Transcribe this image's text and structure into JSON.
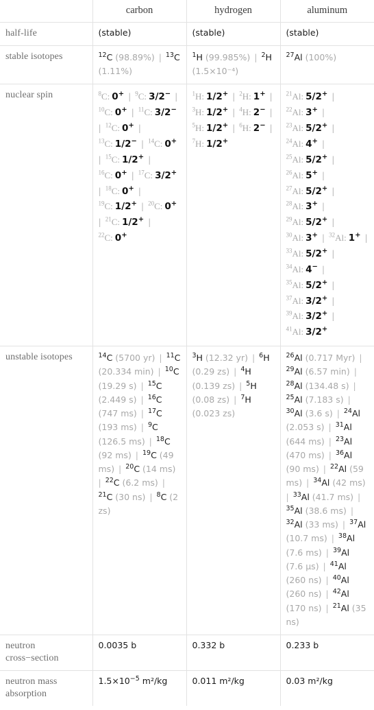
{
  "table": {
    "columns": [
      "carbon",
      "hydrogen",
      "aluminum"
    ],
    "corner_label": "",
    "rows": [
      {
        "label": "half-life",
        "carbon": "(stable)",
        "hydrogen": "(stable)",
        "aluminum": "(stable)"
      },
      {
        "label": "stable isotopes",
        "carbon": "12C (98.89%) | 13C (1.11%)",
        "hydrogen": "1H (99.985%) | 2H (1.5×10^-4)",
        "aluminum": "27Al (100%)"
      },
      {
        "label": "nuclear spin",
        "carbon": "8C: 0+ | 9C: 3/2- | 10C: 0+ | 11C: 3/2- | 12C: 0+ | 13C: 1/2- | 14C: 0+ | 15C: 1/2+ | 16C: 0+ | 17C: 3/2+ | 18C: 0+ | 19C: 1/2+ | 20C: 0+ | 21C: 1/2+ | 22C: 0+",
        "hydrogen": "1H: 1/2+ | 2H: 1+ | 3H: 1/2+ | 4H: 2- | 5H: 1/2+ | 6H: 2- | 7H: 1/2+",
        "aluminum": "21Al: 5/2+ | 22Al: 3+ | 23Al: 5/2+ | 24Al: 4+ | 25Al: 5/2+ | 26Al: 5+ | 27Al: 5/2+ | 28Al: 3+ | 29Al: 5/2+ | 30Al: 3+ | 32Al: 1+ | 33Al: 5/2+ | 34Al: 4- | 35Al: 5/2+ | 37Al: 3/2+ | 39Al: 3/2+ | 41Al: 3/2+"
      },
      {
        "label": "unstable isotopes",
        "carbon": "14C (5700 yr) | 11C (20.334 min) | 10C (19.29 s) | 15C (2.449 s) | 16C (747 ms) | 17C (193 ms) | 9C (126.5 ms) | 18C (92 ms) | 19C (49 ms) | 20C (14 ms) | 22C (6.2 ms) | 21C (30 ns) | 8C (2 zs)",
        "hydrogen": "3H (12.32 yr) | 6H (0.29 zs) | 4H (0.139 zs) | 5H (0.08 zs) | 7H (0.023 zs)",
        "aluminum": "26Al (0.717 Myr) | 29Al (6.57 min) | 28Al (134.48 s) | 25Al (7.183 s) | 30Al (3.6 s) | 24Al (2.053 s) | 31Al (644 ms) | 23Al (470 ms) | 36Al (90 ms) | 22Al (59 ms) | 34Al (42 ms) | 33Al (41.7 ms) | 35Al (38.6 ms) | 32Al (33 ms) | 37Al (10.7 ms) | 38Al (7.6 ms) | 39Al (7.6 µs) | 41Al (260 ns) | 40Al (260 ns) | 42Al (170 ns) | 21Al (35 ns)"
      },
      {
        "label": "neutron cross-section",
        "carbon": "0.0035 b",
        "hydrogen": "0.332 b",
        "aluminum": "0.233 b"
      },
      {
        "label": "neutron mass absorption",
        "carbon": "1.5×10^-5 m^2/kg",
        "hydrogen": "0.011 m²/kg",
        "aluminum": "0.03 m²/kg"
      }
    ]
  },
  "half_life": {
    "carbon": "(stable)",
    "hydrogen": "(stable)",
    "aluminum": "(stable)"
  },
  "stable_isotopes": {
    "carbon": [
      {
        "mass": "12",
        "element": "C",
        "abundance": "(98.89%)"
      },
      {
        "mass": "13",
        "element": "C",
        "abundance": "(1.11%)"
      }
    ],
    "hydrogen": [
      {
        "mass": "1",
        "element": "H",
        "abundance": "(99.985%)"
      },
      {
        "mass": "2",
        "element": "H",
        "abundance": "(1.5×10⁻⁴)"
      }
    ],
    "aluminum": [
      {
        "mass": "27",
        "element": "Al",
        "abundance": "(100%)"
      }
    ]
  },
  "nuclear_spin": {
    "carbon": [
      {
        "mass": "8",
        "element": "C",
        "spin": "0",
        "parity": "+"
      },
      {
        "mass": "9",
        "element": "C",
        "spin": "3/2",
        "parity": "−"
      },
      {
        "mass": "10",
        "element": "C",
        "spin": "0",
        "parity": "+"
      },
      {
        "mass": "11",
        "element": "C",
        "spin": "3/2",
        "parity": "−"
      },
      {
        "mass": "12",
        "element": "C",
        "spin": "0",
        "parity": "+"
      },
      {
        "mass": "13",
        "element": "C",
        "spin": "1/2",
        "parity": "−"
      },
      {
        "mass": "14",
        "element": "C",
        "spin": "0",
        "parity": "+"
      },
      {
        "mass": "15",
        "element": "C",
        "spin": "1/2",
        "parity": "+"
      },
      {
        "mass": "16",
        "element": "C",
        "spin": "0",
        "parity": "+"
      },
      {
        "mass": "17",
        "element": "C",
        "spin": "3/2",
        "parity": "+"
      },
      {
        "mass": "18",
        "element": "C",
        "spin": "0",
        "parity": "+"
      },
      {
        "mass": "19",
        "element": "C",
        "spin": "1/2",
        "parity": "+"
      },
      {
        "mass": "20",
        "element": "C",
        "spin": "0",
        "parity": "+"
      },
      {
        "mass": "21",
        "element": "C",
        "spin": "1/2",
        "parity": "+"
      },
      {
        "mass": "22",
        "element": "C",
        "spin": "0",
        "parity": "+"
      }
    ],
    "hydrogen": [
      {
        "mass": "1",
        "element": "H",
        "spin": "1/2",
        "parity": "+"
      },
      {
        "mass": "2",
        "element": "H",
        "spin": "1",
        "parity": "+"
      },
      {
        "mass": "3",
        "element": "H",
        "spin": "1/2",
        "parity": "+"
      },
      {
        "mass": "4",
        "element": "H",
        "spin": "2",
        "parity": "−"
      },
      {
        "mass": "5",
        "element": "H",
        "spin": "1/2",
        "parity": "+"
      },
      {
        "mass": "6",
        "element": "H",
        "spin": "2",
        "parity": "−"
      },
      {
        "mass": "7",
        "element": "H",
        "spin": "1/2",
        "parity": "+"
      }
    ],
    "aluminum": [
      {
        "mass": "21",
        "element": "Al",
        "spin": "5/2",
        "parity": "+"
      },
      {
        "mass": "22",
        "element": "Al",
        "spin": "3",
        "parity": "+"
      },
      {
        "mass": "23",
        "element": "Al",
        "spin": "5/2",
        "parity": "+"
      },
      {
        "mass": "24",
        "element": "Al",
        "spin": "4",
        "parity": "+"
      },
      {
        "mass": "25",
        "element": "Al",
        "spin": "5/2",
        "parity": "+"
      },
      {
        "mass": "26",
        "element": "Al",
        "spin": "5",
        "parity": "+"
      },
      {
        "mass": "27",
        "element": "Al",
        "spin": "5/2",
        "parity": "+"
      },
      {
        "mass": "28",
        "element": "Al",
        "spin": "3",
        "parity": "+"
      },
      {
        "mass": "29",
        "element": "Al",
        "spin": "5/2",
        "parity": "+"
      },
      {
        "mass": "30",
        "element": "Al",
        "spin": "3",
        "parity": "+"
      },
      {
        "mass": "32",
        "element": "Al",
        "spin": "1",
        "parity": "+"
      },
      {
        "mass": "33",
        "element": "Al",
        "spin": "5/2",
        "parity": "+"
      },
      {
        "mass": "34",
        "element": "Al",
        "spin": "4",
        "parity": "−"
      },
      {
        "mass": "35",
        "element": "Al",
        "spin": "5/2",
        "parity": "+"
      },
      {
        "mass": "37",
        "element": "Al",
        "spin": "3/2",
        "parity": "+"
      },
      {
        "mass": "39",
        "element": "Al",
        "spin": "3/2",
        "parity": "+"
      },
      {
        "mass": "41",
        "element": "Al",
        "spin": "3/2",
        "parity": "+"
      }
    ]
  },
  "unstable_isotopes": {
    "carbon": [
      {
        "mass": "14",
        "element": "C",
        "half_life": "(5700 yr)"
      },
      {
        "mass": "11",
        "element": "C",
        "half_life": "(20.334 min)"
      },
      {
        "mass": "10",
        "element": "C",
        "half_life": "(19.29 s)"
      },
      {
        "mass": "15",
        "element": "C",
        "half_life": "(2.449 s)"
      },
      {
        "mass": "16",
        "element": "C",
        "half_life": "(747 ms)"
      },
      {
        "mass": "17",
        "element": "C",
        "half_life": "(193 ms)"
      },
      {
        "mass": "9",
        "element": "C",
        "half_life": "(126.5 ms)"
      },
      {
        "mass": "18",
        "element": "C",
        "half_life": "(92 ms)"
      },
      {
        "mass": "19",
        "element": "C",
        "half_life": "(49 ms)"
      },
      {
        "mass": "20",
        "element": "C",
        "half_life": "(14 ms)"
      },
      {
        "mass": "22",
        "element": "C",
        "half_life": "(6.2 ms)"
      },
      {
        "mass": "21",
        "element": "C",
        "half_life": "(30 ns)"
      },
      {
        "mass": "8",
        "element": "C",
        "half_life": "(2 zs)"
      }
    ],
    "hydrogen": [
      {
        "mass": "3",
        "element": "H",
        "half_life": "(12.32 yr)"
      },
      {
        "mass": "6",
        "element": "H",
        "half_life": "(0.29 zs)"
      },
      {
        "mass": "4",
        "element": "H",
        "half_life": "(0.139 zs)"
      },
      {
        "mass": "5",
        "element": "H",
        "half_life": "(0.08 zs)"
      },
      {
        "mass": "7",
        "element": "H",
        "half_life": "(0.023 zs)"
      }
    ],
    "aluminum": [
      {
        "mass": "26",
        "element": "Al",
        "half_life": "(0.717 Myr)"
      },
      {
        "mass": "29",
        "element": "Al",
        "half_life": "(6.57 min)"
      },
      {
        "mass": "28",
        "element": "Al",
        "half_life": "(134.48 s)"
      },
      {
        "mass": "25",
        "element": "Al",
        "half_life": "(7.183 s)"
      },
      {
        "mass": "30",
        "element": "Al",
        "half_life": "(3.6 s)"
      },
      {
        "mass": "24",
        "element": "Al",
        "half_life": "(2.053 s)"
      },
      {
        "mass": "31",
        "element": "Al",
        "half_life": "(644 ms)"
      },
      {
        "mass": "23",
        "element": "Al",
        "half_life": "(470 ms)"
      },
      {
        "mass": "36",
        "element": "Al",
        "half_life": "(90 ms)"
      },
      {
        "mass": "22",
        "element": "Al",
        "half_life": "(59 ms)"
      },
      {
        "mass": "34",
        "element": "Al",
        "half_life": "(42 ms)"
      },
      {
        "mass": "33",
        "element": "Al",
        "half_life": "(41.7 ms)"
      },
      {
        "mass": "35",
        "element": "Al",
        "half_life": "(38.6 ms)"
      },
      {
        "mass": "32",
        "element": "Al",
        "half_life": "(33 ms)"
      },
      {
        "mass": "37",
        "element": "Al",
        "half_life": "(10.7 ms)"
      },
      {
        "mass": "38",
        "element": "Al",
        "half_life": "(7.6 ms)"
      },
      {
        "mass": "39",
        "element": "Al",
        "half_life": "(7.6 µs)"
      },
      {
        "mass": "41",
        "element": "Al",
        "half_life": "(260 ns)"
      },
      {
        "mass": "40",
        "element": "Al",
        "half_life": "(260 ns)"
      },
      {
        "mass": "42",
        "element": "Al",
        "half_life": "(170 ns)"
      },
      {
        "mass": "21",
        "element": "Al",
        "half_life": "(35 ns)"
      }
    ]
  },
  "neutron_cross_section": {
    "carbon": "0.0035 b",
    "hydrogen": "0.332 b",
    "aluminum": "0.233 b"
  },
  "neutron_mass_absorption": {
    "carbon_mantissa": "1.5×10",
    "carbon_exponent": "−5",
    "carbon_unit": "m²/kg",
    "hydrogen": "0.011 m²/kg",
    "aluminum": "0.03 m²/kg"
  },
  "labels": {
    "half_life": "half-life",
    "stable_isotopes": "stable isotopes",
    "nuclear_spin": "nuclear spin",
    "unstable_isotopes": "unstable isotopes",
    "neutron_cross_section": "neutron cross−section",
    "neutron_mass_absorption": "neutron mass absorption"
  },
  "separator": "|"
}
